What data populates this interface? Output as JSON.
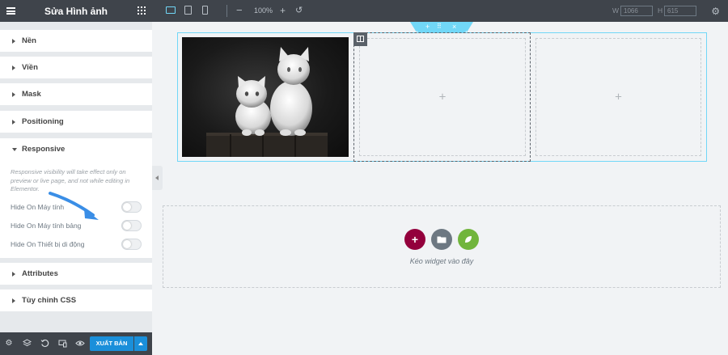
{
  "panel": {
    "title": "Sửa Hình ảnh",
    "sections": [
      {
        "label": "Nền",
        "expanded": false
      },
      {
        "label": "Viền",
        "expanded": false
      },
      {
        "label": "Mask",
        "expanded": false
      },
      {
        "label": "Positioning",
        "expanded": false
      },
      {
        "label": "Responsive",
        "expanded": true
      },
      {
        "label": "Attributes",
        "expanded": false
      },
      {
        "label": "Tùy chỉnh CSS",
        "expanded": false
      }
    ],
    "responsive": {
      "note": "Responsive visibility will take effect only on preview or live page, and not while editing in Elementor.",
      "toggles": [
        {
          "label": "Hide On Máy tính",
          "on": false
        },
        {
          "label": "Hide On Máy tính bảng",
          "on": false
        },
        {
          "label": "Hide On Thiết bị di động",
          "on": false
        }
      ]
    },
    "footer": {
      "publish_label": "XUẤT BẢN"
    }
  },
  "toolbar": {
    "zoom": "100%",
    "width_label": "W",
    "width_value": "1066",
    "height_label": "H",
    "height_value": "615"
  },
  "canvas": {
    "drop_text": "Kéo widget vào đây"
  },
  "colors": {
    "dark_bar": "#3f444b",
    "accent_blue": "#1a8fda",
    "section_outline": "#71d7f7",
    "add_button": "#93003c",
    "template_button": "#6d7882",
    "kit_button": "#71b53c",
    "arrow": "#3a8ee6"
  }
}
